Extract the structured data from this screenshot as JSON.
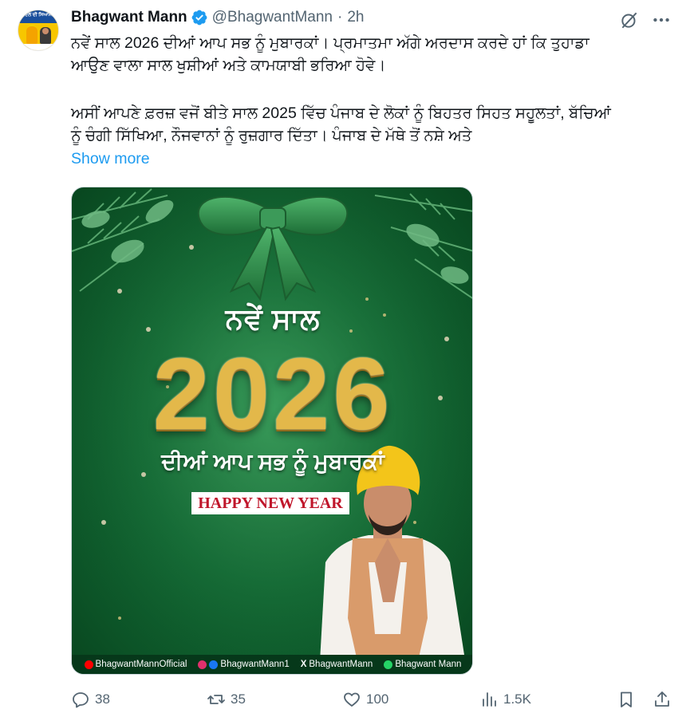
{
  "author": {
    "name": "Bhagwant Mann",
    "handle": "@BhagwantMann",
    "time": "2h",
    "avatar_label": "ਬਦਲ ਦੀ ਸਿਆਸਤ"
  },
  "tweet": {
    "paragraph1": "ਨਵੇਂ ਸਾਲ 2026 ਦੀਆਂ ਆਪ ਸਭ ਨੂੰ ਮੁਬਾਰਕਾਂ। ਪ੍ਰਮਾਤਮਾ ਅੱਗੇ ਅਰਦਾਸ ਕਰਦੇ ਹਾਂ ਕਿ ਤੁਹਾਡਾ\nਆਉਣ ਵਾਲਾ ਸਾਲ ਖੁਸ਼ੀਆਂ ਅਤੇ ਕਾਮਯਾਬੀ ਭਰਿਆ ਹੋਵੇ।",
    "paragraph2": "ਅਸੀਂ ਆਪਣੇ ਫ਼ਰਜ਼ ਵਜੋਂ ਬੀਤੇ ਸਾਲ 2025 ਵਿੱਚ ਪੰਜਾਬ ਦੇ ਲੋਕਾਂ ਨੂੰ ਬਿਹਤਰ ਸਿਹਤ ਸਹੂਲਤਾਂ, ਬੱਚਿਆਂ\nਨੂੰ ਚੰਗੀ ਸਿੱਖਿਆ, ਨੌਜਵਾਨਾਂ ਨੂੰ ਰੁਜ਼ਗਾਰ ਦਿੱਤਾ। ਪੰਜਾਬ ਦੇ ਮੱਥੇ ਤੋਂ ਨਸ਼ੇ ਅਤੇ",
    "show_more": "Show more"
  },
  "media": {
    "greeting_top": "ਨਵੇਂ ਸਾਲ",
    "year": "2026",
    "greeting_mid": "ਦੀਆਂ ਆਪ ਸਭ ਨੂੰ ਮੁਬਾਰਕਾਂ",
    "banner": "HAPPY NEW YEAR",
    "socials": [
      {
        "icon": "youtube-icon",
        "label": "BhagwantMannOfficial",
        "color": "#ff0000"
      },
      {
        "icon": "instagram-facebook-icon",
        "label": "BhagwantMann1",
        "color": "#e1306c"
      },
      {
        "icon": "x-icon",
        "label": "BhagwantMann",
        "color": "#000000"
      },
      {
        "icon": "whatsapp-icon",
        "label": "Bhagwant Mann",
        "color": "#25d366"
      }
    ]
  },
  "actions": {
    "replies": "38",
    "reposts": "35",
    "likes": "100",
    "views": "1.5K"
  },
  "colors": {
    "text": "#0f1419",
    "secondary": "#536471",
    "link": "#1d9bf0",
    "verified": "#1d9bf0"
  }
}
